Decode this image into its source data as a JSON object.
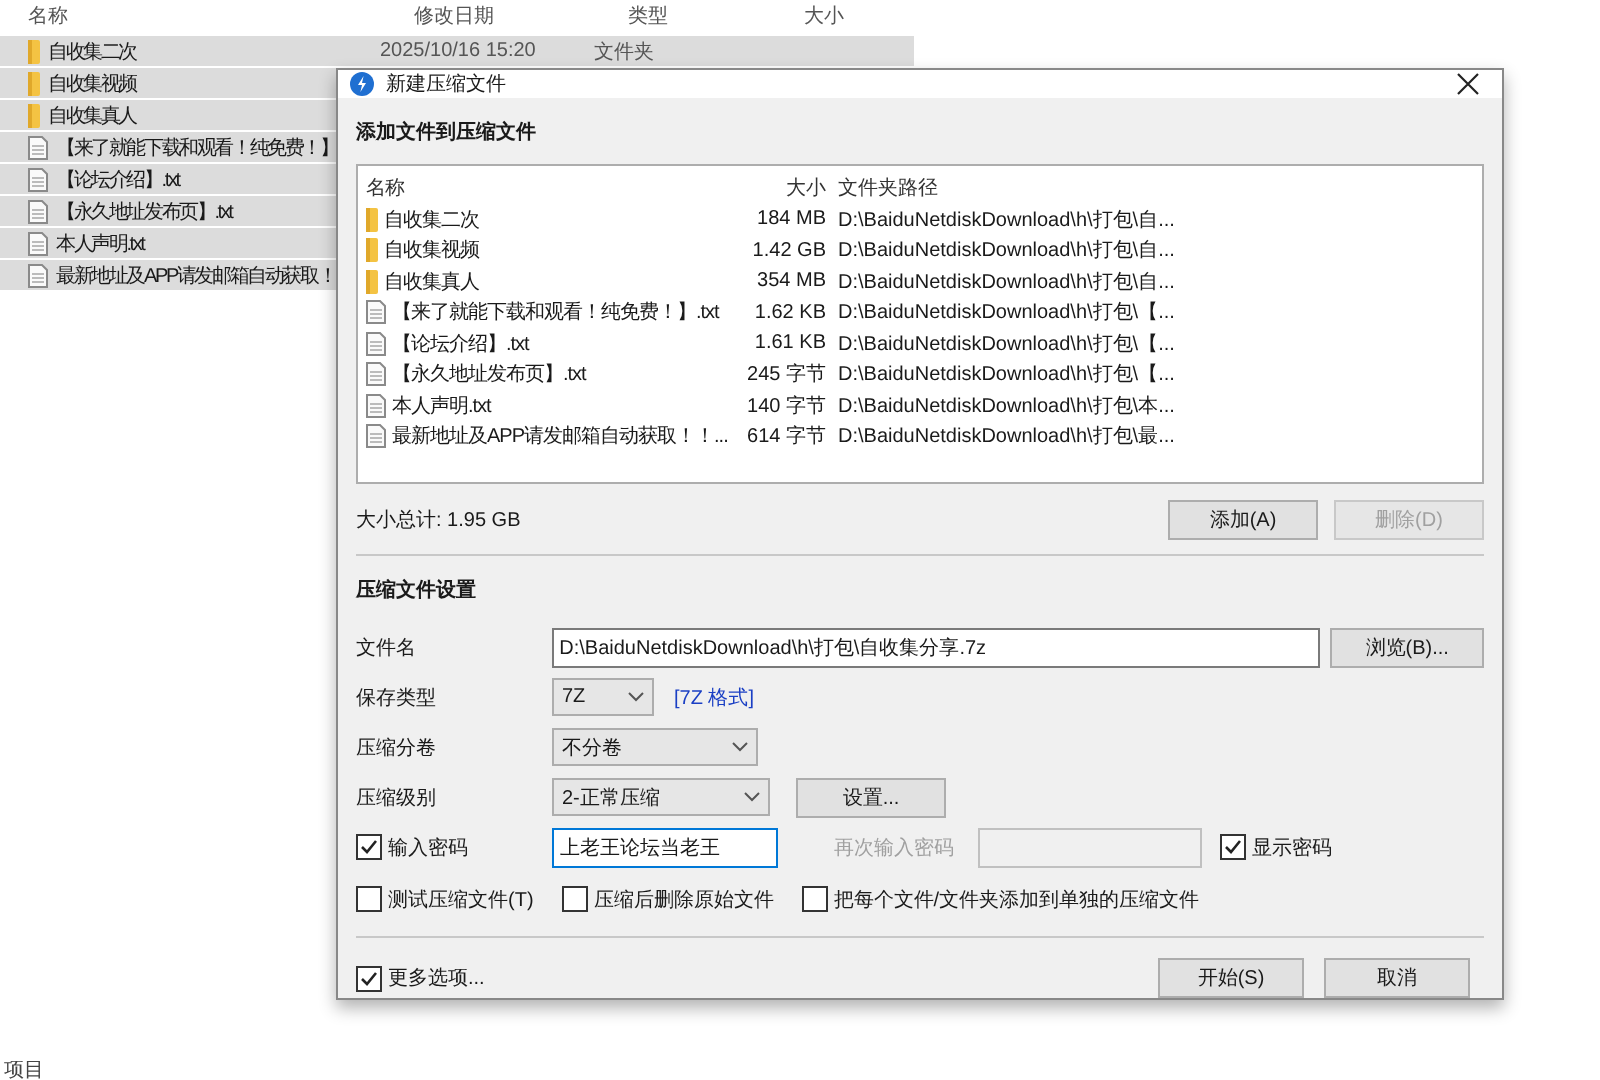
{
  "explorer": {
    "columns": [
      "名称",
      "修改日期",
      "类型",
      "大小"
    ],
    "rows": [
      {
        "name": "自收集二次",
        "kind": "folder",
        "date": "2025/10/16 15:20",
        "type": "文件夹",
        "selected": true
      },
      {
        "name": "自收集视频",
        "kind": "folder",
        "selected": true
      },
      {
        "name": "自收集真人",
        "kind": "folder",
        "selected": true
      },
      {
        "name": "【来了就能下载和观看！纯免费！】",
        "kind": "file",
        "selected": true
      },
      {
        "name": "【论坛介绍】.txt",
        "kind": "file",
        "selected": true
      },
      {
        "name": "【永久地址发布页】.txt",
        "kind": "file",
        "selected": true
      },
      {
        "name": "本人声明.txt",
        "kind": "file",
        "selected": true
      },
      {
        "name": "最新地址及APP请发邮箱自动获取！",
        "kind": "file",
        "selected": true
      }
    ],
    "status": "项目"
  },
  "dialog": {
    "title": "新建压缩文件",
    "add_heading": "添加文件到压缩文件",
    "file_list": {
      "columns": [
        "名称",
        "大小",
        "文件夹路径"
      ],
      "rows": [
        {
          "name": "自收集二次",
          "kind": "folder",
          "size": "184 MB",
          "path": "D:\\BaiduNetdiskDownload\\h\\打包\\自..."
        },
        {
          "name": "自收集视频",
          "kind": "folder",
          "size": "1.42 GB",
          "path": "D:\\BaiduNetdiskDownload\\h\\打包\\自..."
        },
        {
          "name": "自收集真人",
          "kind": "folder",
          "size": "354 MB",
          "path": "D:\\BaiduNetdiskDownload\\h\\打包\\自..."
        },
        {
          "name": "【来了就能下载和观看！纯免费！】.txt",
          "kind": "file",
          "size": "1.62 KB",
          "path": "D:\\BaiduNetdiskDownload\\h\\打包\\【..."
        },
        {
          "name": "【论坛介绍】.txt",
          "kind": "file",
          "size": "1.61 KB",
          "path": "D:\\BaiduNetdiskDownload\\h\\打包\\【..."
        },
        {
          "name": "【永久地址发布页】.txt",
          "kind": "file",
          "size": "245 字节",
          "path": "D:\\BaiduNetdiskDownload\\h\\打包\\【..."
        },
        {
          "name": "本人声明.txt",
          "kind": "file",
          "size": "140 字节",
          "path": "D:\\BaiduNetdiskDownload\\h\\打包\\本..."
        },
        {
          "name": "最新地址及APP请发邮箱自动获取！！...",
          "kind": "file",
          "size": "614 字节",
          "path": "D:\\BaiduNetdiskDownload\\h\\打包\\最..."
        }
      ]
    },
    "total": "大小总计: 1.95 GB",
    "add_button": {
      "label": "添加(A)",
      "disabled": false
    },
    "remove_button": {
      "label": "删除(D)",
      "disabled": true
    },
    "settings_heading": "压缩文件设置",
    "filename": {
      "label": "文件名",
      "value": "D:\\BaiduNetdiskDownload\\h\\打包\\自收集分享.7z",
      "browse": "浏览(B)..."
    },
    "save_type": {
      "label": "保存类型",
      "value": "7Z",
      "link": "[7Z 格式]"
    },
    "split": {
      "label": "压缩分卷",
      "value": "不分卷"
    },
    "level": {
      "label": "压缩级别",
      "value": "2-正常压缩",
      "settings": "设置..."
    },
    "password": {
      "label": "输入密码",
      "checked": true,
      "value": "上老王论坛当老王",
      "repeat_label": "再次输入密码",
      "show_label": "显示密码",
      "show_checked": true
    },
    "options": [
      {
        "label": "测试压缩文件(T)",
        "checked": false
      },
      {
        "label": "压缩后删除原始文件",
        "checked": false
      },
      {
        "label": "把每个文件/文件夹添加到单独的压缩文件",
        "checked": false
      }
    ],
    "more": {
      "label": "更多选项...",
      "checked": true
    },
    "start": "开始(S)",
    "cancel": "取消"
  }
}
